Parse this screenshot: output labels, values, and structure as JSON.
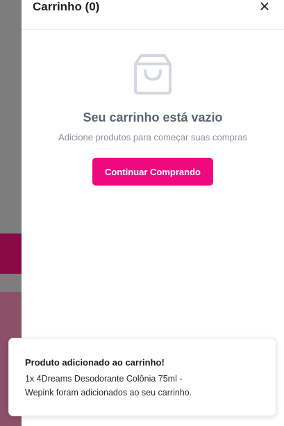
{
  "cart": {
    "title": "Carrinho (0)",
    "close_icon": "close-icon",
    "empty_icon": "shopping-bag-icon",
    "empty_title": "Seu carrinho está vazio",
    "empty_subtitle": "Adicione produtos para começar suas compras",
    "continue_label": "Continuar Comprando"
  },
  "toast": {
    "title": "Produto adicionado ao carrinho!",
    "message": "1x 4Dreams Desodorante Colônia 75ml - Wepink foram adicionados ao seu carrinho."
  },
  "colors": {
    "accent": "#f0097e",
    "overlay": "#7d7d7d",
    "background_band": "#8a0a45"
  }
}
